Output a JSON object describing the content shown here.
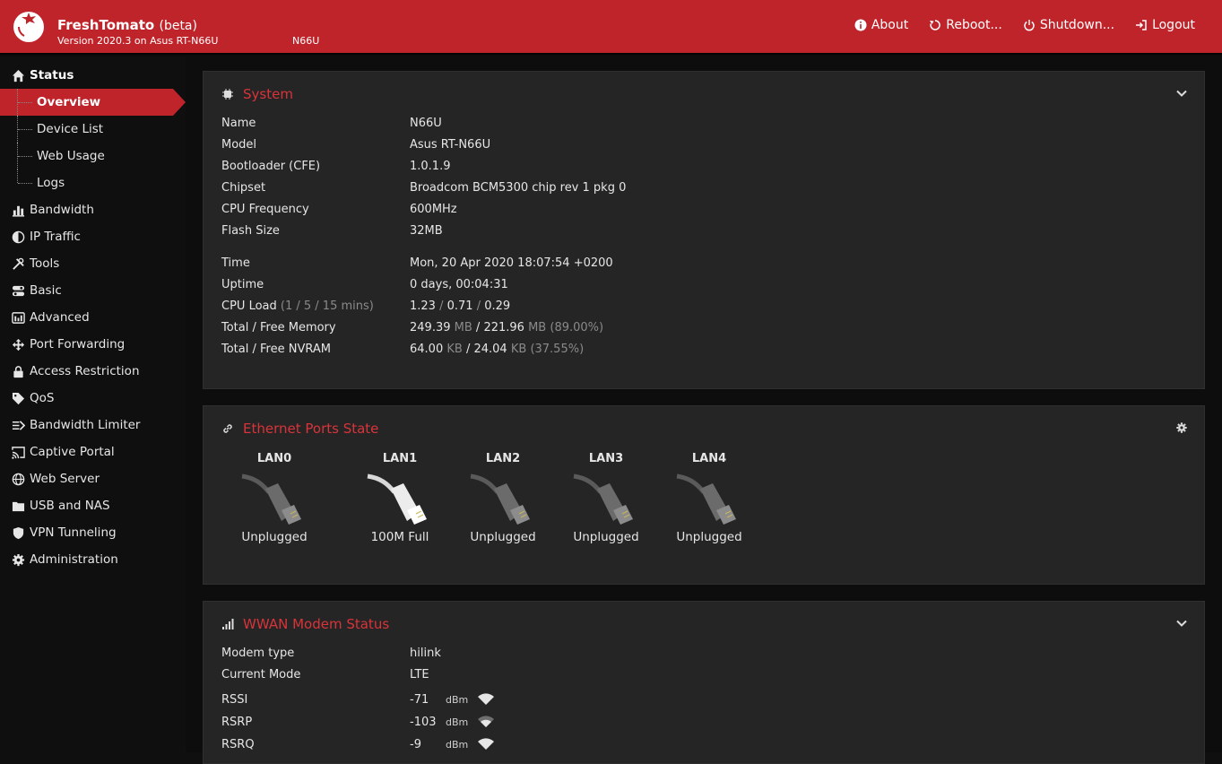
{
  "header": {
    "title": "FreshTomato",
    "beta": "(beta)",
    "version": "Version 2020.3 on Asus RT-N66U",
    "hostname": "N66U",
    "nav": [
      {
        "label": "About",
        "icon": "info-icon"
      },
      {
        "label": "Reboot...",
        "icon": "reboot-icon"
      },
      {
        "label": "Shutdown...",
        "icon": "power-icon"
      },
      {
        "label": "Logout",
        "icon": "logout-icon"
      }
    ]
  },
  "sidebar": {
    "status": "Status",
    "subs": [
      "Overview",
      "Device List",
      "Web Usage",
      "Logs"
    ],
    "items": [
      {
        "label": "Bandwidth",
        "icon": "bar-chart-icon"
      },
      {
        "label": "IP Traffic",
        "icon": "pie-chart-icon"
      },
      {
        "label": "Tools",
        "icon": "tools-icon"
      },
      {
        "label": "Basic",
        "icon": "toggles-icon"
      },
      {
        "label": "Advanced",
        "icon": "advanced-icon"
      },
      {
        "label": "Port Forwarding",
        "icon": "forwarding-icon"
      },
      {
        "label": "Access Restriction",
        "icon": "lock-icon"
      },
      {
        "label": "QoS",
        "icon": "tag-icon"
      },
      {
        "label": "Bandwidth Limiter",
        "icon": "limiter-icon"
      },
      {
        "label": "Captive Portal",
        "icon": "cast-icon"
      },
      {
        "label": "Web Server",
        "icon": "globe-icon"
      },
      {
        "label": "USB and NAS",
        "icon": "folder-icon"
      },
      {
        "label": "VPN Tunneling",
        "icon": "shield-icon"
      },
      {
        "label": "Administration",
        "icon": "gear-icon"
      }
    ]
  },
  "system": {
    "title": "System",
    "rows1": [
      {
        "k": "Name",
        "v": "N66U"
      },
      {
        "k": "Model",
        "v": "Asus RT-N66U"
      },
      {
        "k": "Bootloader (CFE)",
        "v": "1.0.1.9"
      },
      {
        "k": "Chipset",
        "v": "Broadcom BCM5300 chip rev 1 pkg 0"
      },
      {
        "k": "CPU Frequency",
        "v": "600MHz"
      },
      {
        "k": "Flash Size",
        "v": "32MB"
      }
    ],
    "time_label": "Time",
    "time": "Mon, 20 Apr 2020 18:07:54 +0200",
    "uptime_label": "Uptime",
    "uptime": "0 days, 00:04:31",
    "cpu_label": "CPU Load",
    "cpu_hint": "(1 / 5 / 15 mins)",
    "cpu_1": "1.23",
    "cpu_5": "0.71",
    "cpu_15": "0.29",
    "slash": "/",
    "mem_label": "Total / Free Memory",
    "mem_total": "249.39",
    "mem_free": "221.96",
    "mem_unit": "MB",
    "mem_pct": "(89.00%)",
    "nvram_label": "Total / Free NVRAM",
    "nvram_total": "64.00",
    "nvram_free": "24.04",
    "nvram_unit": "KB",
    "nvram_pct": "(37.55%)"
  },
  "ethernet": {
    "title": "Ethernet Ports State",
    "ports": [
      {
        "name": "LAN0",
        "state": "Unplugged",
        "connected": false
      },
      {
        "name": "LAN1",
        "state": "100M Full",
        "connected": true
      },
      {
        "name": "LAN2",
        "state": "Unplugged",
        "connected": false
      },
      {
        "name": "LAN3",
        "state": "Unplugged",
        "connected": false
      },
      {
        "name": "LAN4",
        "state": "Unplugged",
        "connected": false
      }
    ]
  },
  "wwan": {
    "title": "WWAN Modem Status",
    "modem_type_label": "Modem type",
    "modem_type": "hilink",
    "mode_label": "Current Mode",
    "mode": "LTE",
    "signals": [
      {
        "k": "RSSI",
        "v": "-71",
        "unit": "dBm"
      },
      {
        "k": "RSRP",
        "v": "-103",
        "unit": "dBm"
      },
      {
        "k": "RSRQ",
        "v": "-9",
        "unit": "dBm"
      }
    ]
  }
}
